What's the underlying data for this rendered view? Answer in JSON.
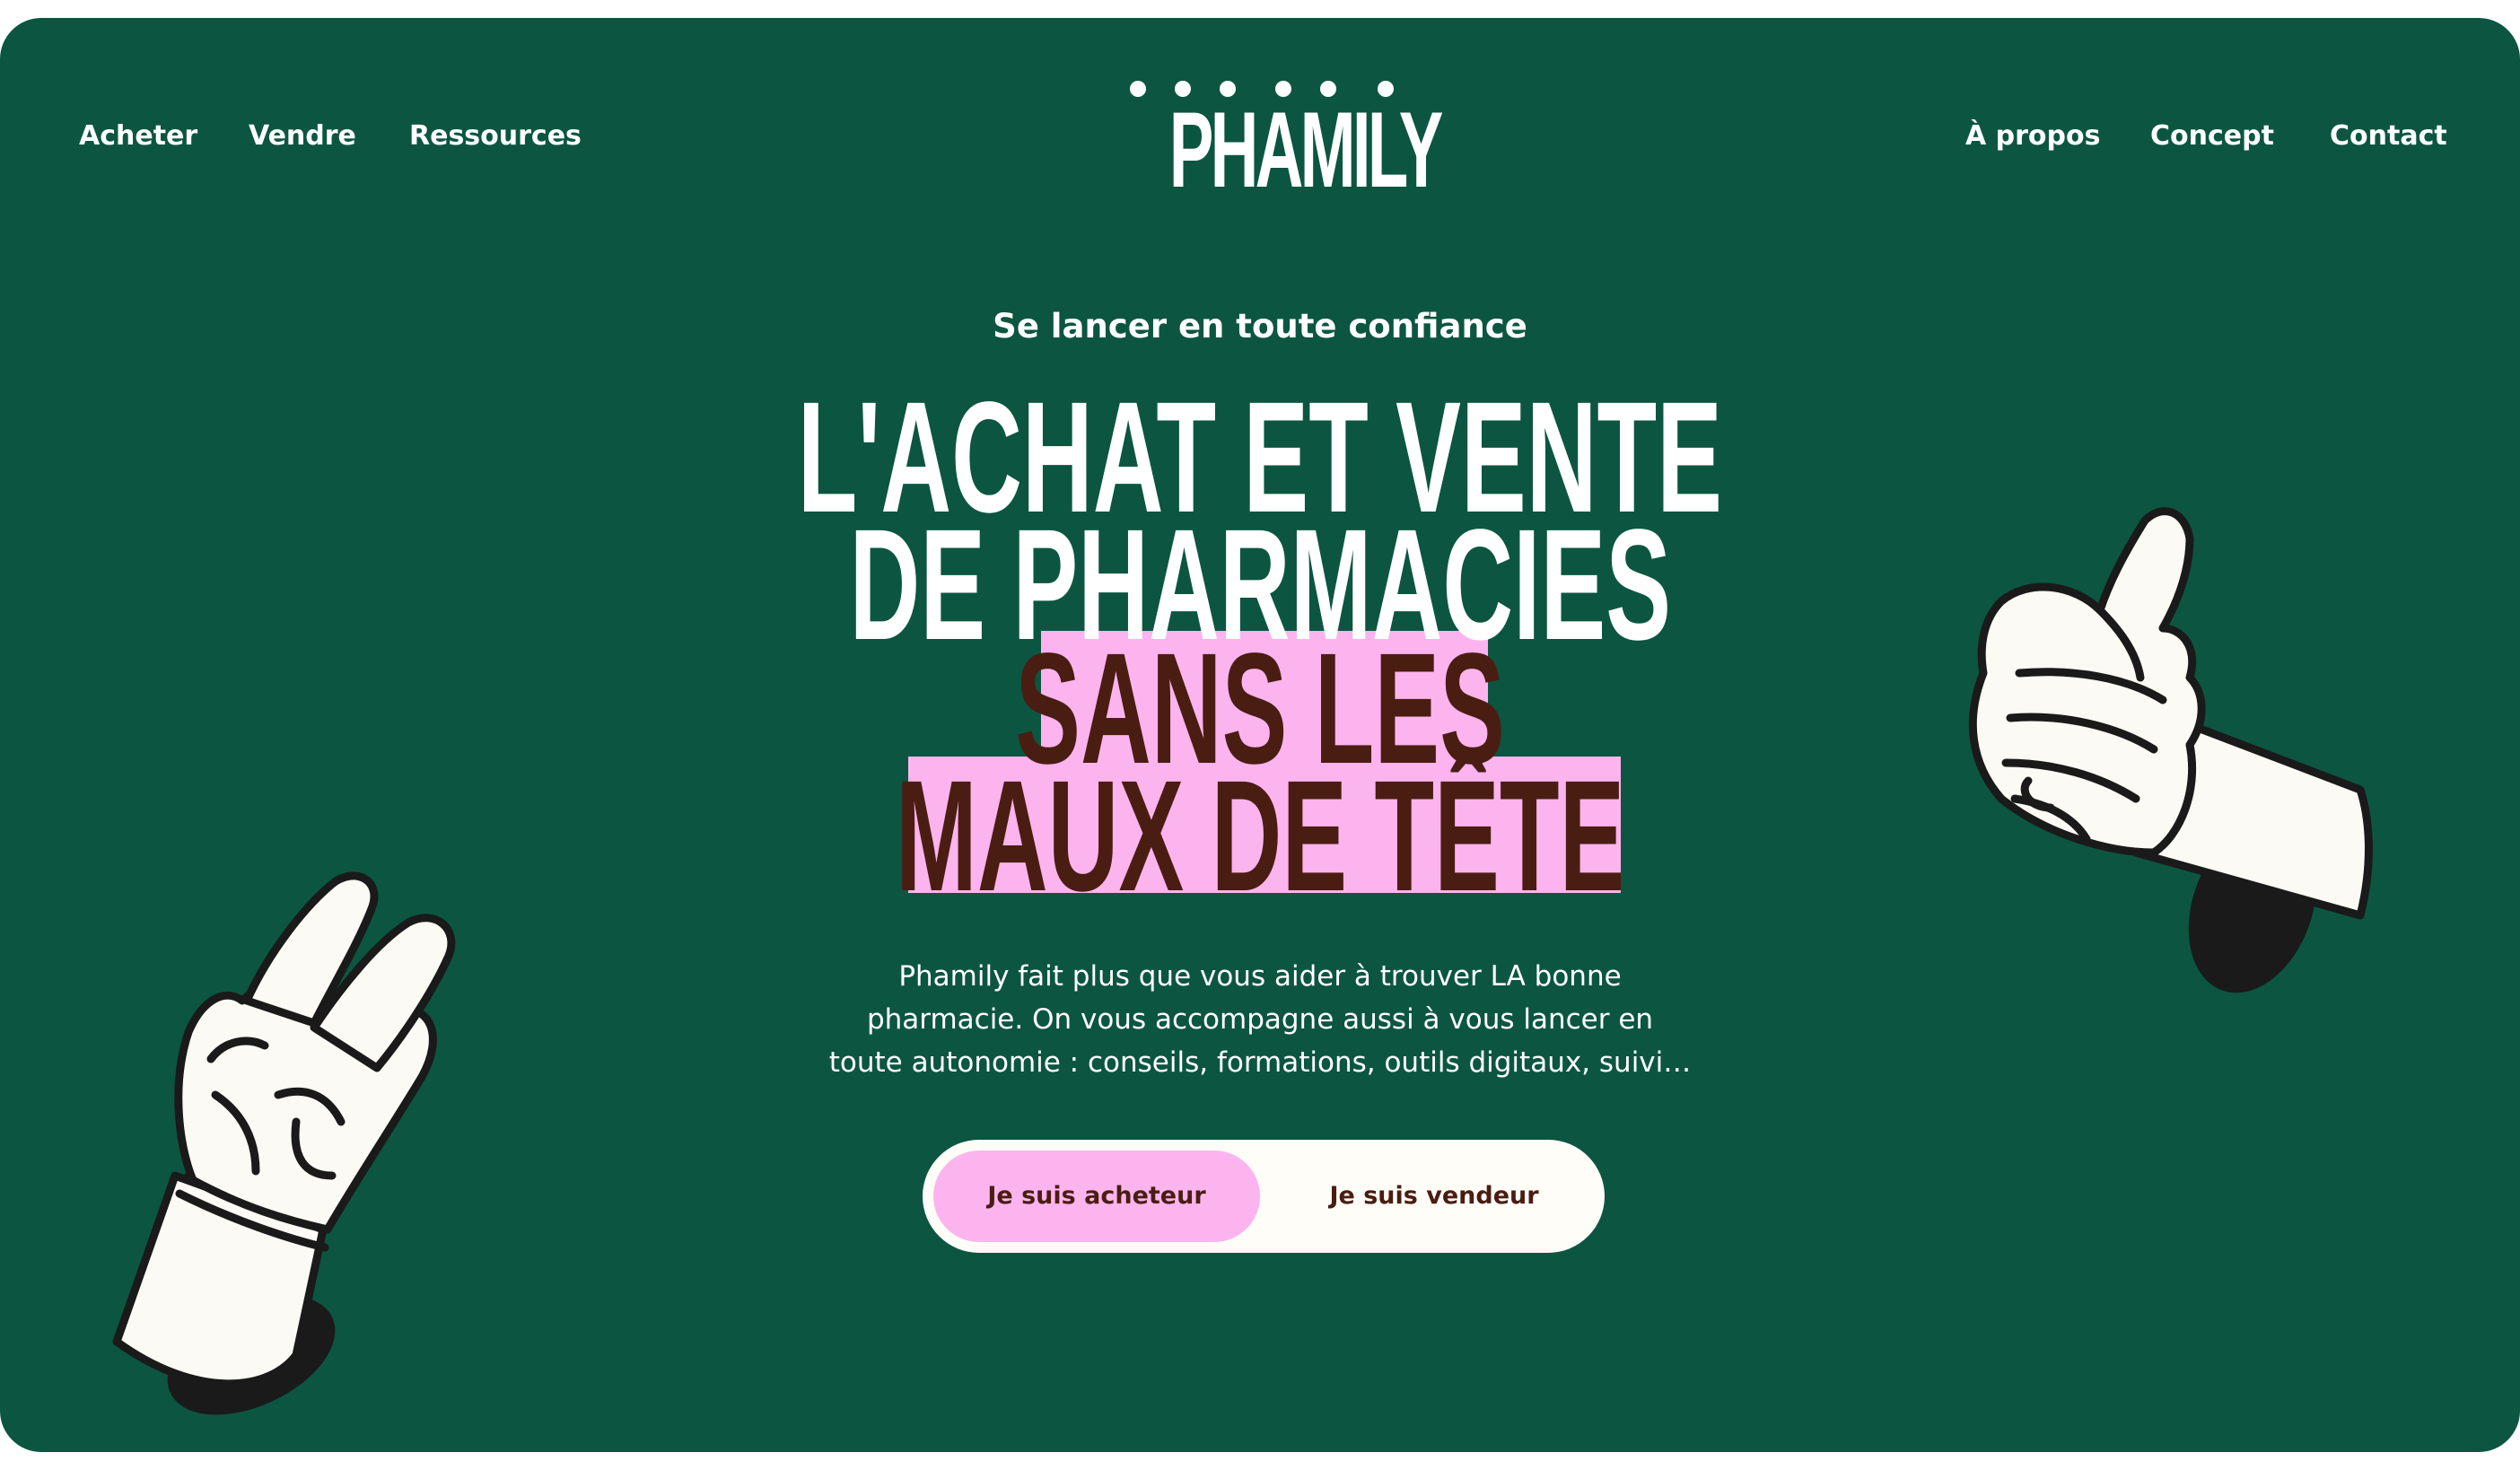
{
  "nav": {
    "left": [
      "Acheter",
      "Vendre",
      "Ressources"
    ],
    "right": [
      "À propos",
      "Concept",
      "Contact"
    ]
  },
  "brand": {
    "name": "PHAMILY"
  },
  "hero": {
    "kicker": "Se lancer en toute confiance",
    "headline": {
      "line1": "L'ACHAT ET VENTE",
      "line2": "DE PHARMACIES",
      "line3": "SANS LES",
      "line4": "MAUX DE TÊTE"
    },
    "description": [
      "Phamily fait plus que vous aider à trouver LA bonne",
      "pharmacie. On vous accompagne aussi à vous lancer en",
      "toute autonomie : conseils, formations, outils digitaux, suivi…"
    ],
    "buttons": {
      "buyer": "Je suis acheteur",
      "seller": "Je suis vendeur"
    }
  },
  "colors": {
    "background": "#0c5641",
    "highlight": "#fcb4ee",
    "highlight_text": "#4a1d12",
    "text": "#ffffff",
    "switch_bg": "#fefdf8"
  },
  "icons": {
    "left_illustration": "peace-hand-icon",
    "right_illustration": "thumbs-up-hand-icon"
  }
}
